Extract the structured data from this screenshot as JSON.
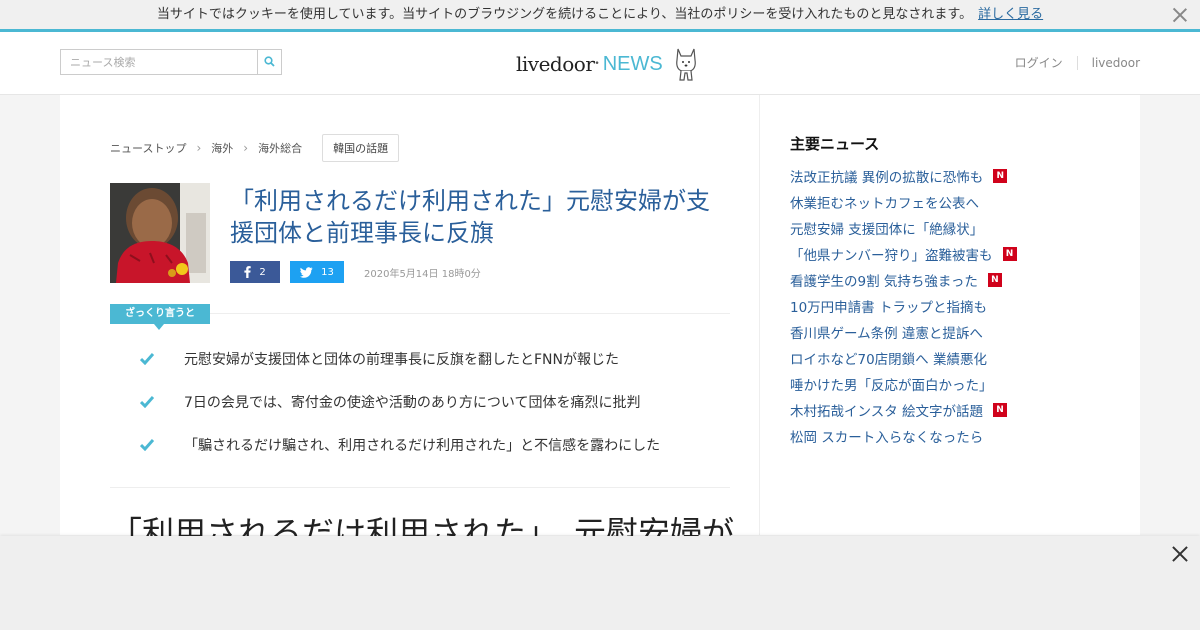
{
  "cookie_bar": {
    "message": "当サイトではクッキーを使用しています。当サイトのブラウジングを続けることにより、当社のポリシーを受け入れたものと見なされます。",
    "link_label": "詳しく見る"
  },
  "header": {
    "search_placeholder": "ニュース検索",
    "logo_main": "livedoor",
    "logo_dot": "•",
    "logo_sub": "NEWS",
    "nav": {
      "login": "ログイン",
      "livedoor": "livedoor"
    }
  },
  "breadcrumb": {
    "items": [
      "ニューストップ",
      "海外",
      "海外総合"
    ],
    "separator": "›",
    "tag": "韓国の話題"
  },
  "article": {
    "headline": "「利用されるだけ利用された」元慰安婦が支援団体と前理事長に反旗",
    "share": {
      "facebook_count": "2",
      "twitter_count": "13"
    },
    "date": "2020年5月14日 18時0分",
    "summary_label": "ざっくり言うと",
    "summary_points": [
      "元慰安婦が支援団体と団体の前理事長に反旗を翻したとFNNが報じた",
      "7日の会見では、寄付金の使途や活動のあり方について団体を痛烈に批判",
      "「騙されるだけ騙され、利用されるだけ利用された」と不信感を露わにした"
    ],
    "body_title": "「利用されるだけ利用された」　元慰安婦が"
  },
  "sidebar": {
    "title": "主要ニュース",
    "new_badge": "N",
    "topics": [
      {
        "label": "法改正抗議 異例の拡散に恐怖も",
        "is_new": true
      },
      {
        "label": "休業拒むネットカフェを公表へ",
        "is_new": false
      },
      {
        "label": "元慰安婦 支援団体に「絶縁状」",
        "is_new": false
      },
      {
        "label": "「他県ナンバー狩り」盗難被害も",
        "is_new": true
      },
      {
        "label": "看護学生の9割 気持ち強まった",
        "is_new": true
      },
      {
        "label": "10万円申請書 トラップと指摘も",
        "is_new": false
      },
      {
        "label": "香川県ゲーム条例 違憲と提訴へ",
        "is_new": false
      },
      {
        "label": "ロイホなど70店閉鎖へ 業績悪化",
        "is_new": false
      },
      {
        "label": "唾かけた男「反応が面白かった」",
        "is_new": false
      },
      {
        "label": "木村拓哉インスタ 絵文字が話題",
        "is_new": true
      },
      {
        "label": "松岡 スカート入らなくなったら",
        "is_new": false
      }
    ]
  },
  "colors": {
    "accent": "#4bb8d3",
    "link": "#2a5f9a",
    "facebook": "#3b5998",
    "twitter": "#1da1f2",
    "new_badge": "#d0021b"
  },
  "icons": {
    "search": "search-icon",
    "close": "close-icon",
    "check": "check-icon",
    "facebook": "facebook-icon",
    "twitter": "twitter-icon",
    "mascot": "dog-mascot-icon"
  }
}
